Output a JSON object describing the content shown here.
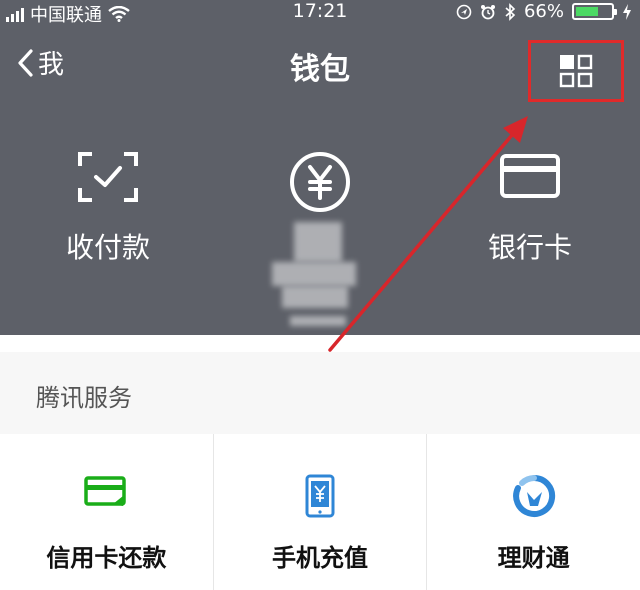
{
  "status_bar": {
    "carrier": "中国联通",
    "time": "17:21",
    "battery": "66%",
    "battery_level": 0.66,
    "icons": [
      "signal-icon",
      "wifi-icon",
      "location-icon",
      "alarm-icon",
      "bluetooth-icon",
      "battery-icon",
      "charging-icon"
    ]
  },
  "nav": {
    "back_label": "我",
    "title": "钱包",
    "more_icon": "grid-menu-icon"
  },
  "quick_actions": [
    {
      "label": "收付款",
      "icon": "scan-pay-icon"
    },
    {
      "label": "",
      "icon": "yuan-coin-icon"
    },
    {
      "label": "银行卡",
      "icon": "bank-card-icon"
    }
  ],
  "section": {
    "title": "腾讯服务"
  },
  "services": [
    {
      "label": "信用卡还款",
      "icon": "credit-card-repay-icon"
    },
    {
      "label": "手机充值",
      "icon": "phone-recharge-icon"
    },
    {
      "label": "理财通",
      "icon": "wealth-management-icon"
    }
  ],
  "colors": {
    "header_bg": "#5d6068",
    "highlight_red": "#e02a2a",
    "green_icon": "#1aad19",
    "blue_icon": "#2f86d6"
  }
}
